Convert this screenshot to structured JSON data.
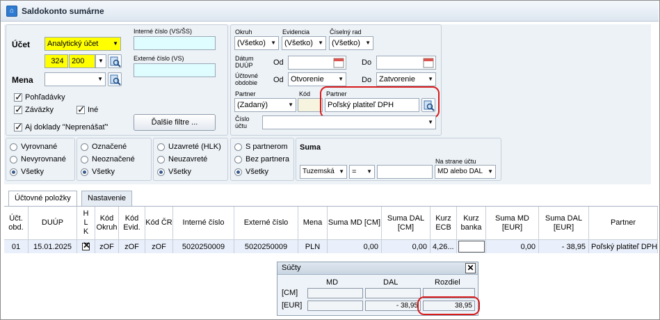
{
  "window": {
    "title": "Saldokonto sumárne"
  },
  "ucet": {
    "label": "Účet",
    "type_value": "Analytický účet",
    "syn": "324",
    "anal": "200"
  },
  "mena": {
    "label": "Mena",
    "value": ""
  },
  "interne": {
    "label": "Interné číslo (VS/ŠS)",
    "value": ""
  },
  "externe": {
    "label": "Externé číslo (VS)",
    "value": ""
  },
  "checks": {
    "pohladavky": "Pohľadávky",
    "zavazky": "Záväzky",
    "ine": "Iné",
    "neprenasat": "Aj doklady \"Neprenášať\""
  },
  "buttons": {
    "dalsie": "Ďalšie filtre ..."
  },
  "okruh": {
    "label": "Okruh",
    "value": "(Všetko)"
  },
  "evidencia": {
    "label": "Evidencia",
    "value": "(Všetko)"
  },
  "rad": {
    "label": "Číselný rad",
    "value": "(Všetko)"
  },
  "datum": {
    "label1": "Dátum",
    "label2": "DUÚP",
    "od": "Od",
    "do": "Do",
    "od_value": "",
    "do_value": ""
  },
  "obdobie": {
    "label1": "Účtovné",
    "label2": "obdobie",
    "od": "Od",
    "do": "Do",
    "od_value": "Otvorenie",
    "do_value": "Zatvorenie"
  },
  "partner_filter": {
    "label": "Partner",
    "value": "(Zadaný)",
    "kod_label": "Kód",
    "name_label": "Partner",
    "name_value": "Poľský platiteľ DPH"
  },
  "cislo_uctu": {
    "label1": "Číslo",
    "label2": "účtu",
    "value": ""
  },
  "radios": {
    "g1": [
      "Vyrovnané",
      "Nevyrovnané",
      "Všetky"
    ],
    "g2": [
      "Označené",
      "Neoznačené",
      "Všetky"
    ],
    "g3": [
      "Uzavreté (HLK)",
      "Neuzavreté",
      "Všetky"
    ],
    "g4": [
      "S partnerom",
      "Bez partnera",
      "Všetky"
    ]
  },
  "suma": {
    "label": "Suma",
    "mena_value": "Tuzemská",
    "op_value": "=",
    "amount": "",
    "strana_label": "Na strane účtu",
    "strana_value": "MD alebo DAL"
  },
  "tabs": [
    "Účtovné položky",
    "Nastavenie"
  ],
  "columns": [
    "Účt. obd.",
    "DUÚP",
    "H L K",
    "Kód Okruh",
    "Kód Evid.",
    "Kód ČR",
    "Interné číslo",
    "Externé číslo",
    "Mena",
    "Suma MD [CM]",
    "Suma DAL [CM]",
    "Kurz ECB",
    "Kurz banka",
    "Suma MD [EUR]",
    "Suma DAL [EUR]",
    "Partner"
  ],
  "rows": [
    [
      "01",
      "15.01.2025",
      "",
      "zOF",
      "zOF",
      "zOF",
      "5020250009",
      "5020250009",
      "PLN",
      "0,00",
      "0,00",
      "4,26...",
      "",
      "0,00",
      "-  38,95",
      "Poľský platiteľ DPH"
    ]
  ],
  "soucty": {
    "title": "Súčty",
    "col_md": "MD",
    "col_dal": "DAL",
    "col_rozdiel": "Rozdiel",
    "row_cm": "[CM]",
    "row_eur": "[EUR]",
    "cm_md": "",
    "cm_dal": "",
    "cm_roz": "",
    "eur_md": "",
    "eur_dal": "-  38,95",
    "eur_roz": "38,95"
  }
}
